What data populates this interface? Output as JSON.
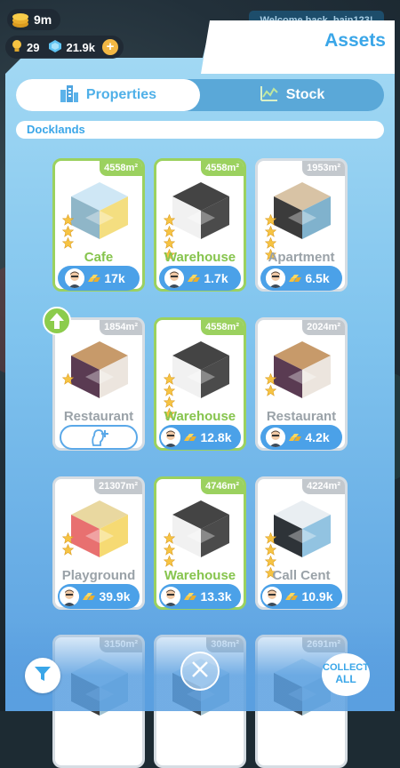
{
  "hud": {
    "money": "9m",
    "bulbs": "29",
    "gems": "21.9k",
    "welcome": "Welcome back, bain123!"
  },
  "panel": {
    "title": "Assets",
    "tabs": [
      {
        "label": "Properties",
        "icon": "buildings-icon",
        "active": true
      },
      {
        "label": "Stock",
        "icon": "stock-chart-icon",
        "active": false
      }
    ],
    "region": "Docklands"
  },
  "cards": [
    {
      "name": "Cafe",
      "area": "4558m²",
      "stars": 3,
      "income": "17k",
      "style": "green"
    },
    {
      "name": "Warehouse",
      "area": "4558m²",
      "stars": 4,
      "income": "1.7k",
      "style": "green"
    },
    {
      "name": "Apartment",
      "area": "1953m²",
      "stars": 4,
      "income": "6.5k",
      "style": "grey"
    },
    {
      "name": "Restaurant",
      "area": "1854m²",
      "stars": 1,
      "income": null,
      "style": "grey"
    },
    {
      "name": "Warehouse",
      "area": "4558m²",
      "stars": 4,
      "income": "12.8k",
      "style": "green"
    },
    {
      "name": "Restaurant",
      "area": "2024m²",
      "stars": 2,
      "income": "4.2k",
      "style": "grey"
    },
    {
      "name": "Playground",
      "area": "21307m²",
      "stars": 2,
      "income": "39.9k",
      "style": "grey"
    },
    {
      "name": "Warehouse",
      "area": "4746m²",
      "stars": 3,
      "income": "13.3k",
      "style": "green"
    },
    {
      "name": "Call Cent",
      "area": "4224m²",
      "stars": 4,
      "income": "10.9k",
      "style": "grey"
    },
    {
      "name": "",
      "area": "3150m²",
      "stars": 0,
      "income": null,
      "style": "grey"
    },
    {
      "name": "",
      "area": "308m²",
      "stars": 0,
      "income": null,
      "style": "grey"
    },
    {
      "name": "",
      "area": "2691m²",
      "stars": 0,
      "income": null,
      "style": "grey"
    }
  ],
  "buttons": {
    "collect_line1": "COLLECT",
    "collect_line2": "ALL"
  },
  "colors": {
    "accent": "#3aa6e8",
    "owned_green": "#9bd15f",
    "income_blue": "#4ba1e8"
  }
}
